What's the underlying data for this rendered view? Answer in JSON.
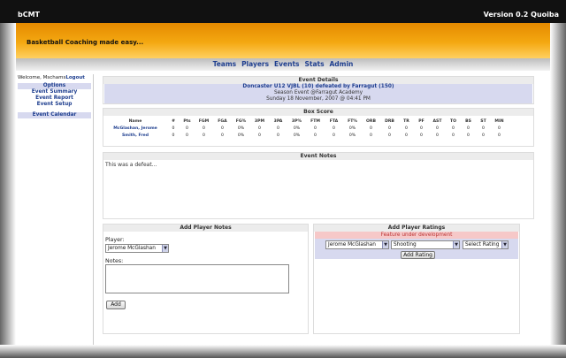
{
  "app": {
    "name": "bCMT",
    "version": "Version 0.2 Quoiba"
  },
  "banner": {
    "tagline": "Basketball Coaching made easy..."
  },
  "nav": [
    "Teams",
    "Players",
    "Events",
    "Stats",
    "Admin"
  ],
  "sidebar": {
    "welcome_prefix": "Welcome, Mschams",
    "logout": "Logout",
    "items1": [
      "Options",
      "Event Summary",
      "Event Report",
      "Event Setup"
    ],
    "items2": [
      "Event Calendar"
    ]
  },
  "event_details": {
    "title": "Event Details",
    "teams": "Doncaster U12 VJBL (10) defeated by Farragut (150)",
    "type": "Season Event @Farragut Academy",
    "datetime": "Sunday 18 November, 2007 @ 04:41 PM"
  },
  "box_score": {
    "title": "Box Score",
    "columns": [
      "Name",
      "#",
      "Pts",
      "FGM",
      "FGA",
      "FG%",
      "3PM",
      "3PA",
      "3P%",
      "FTM",
      "FTA",
      "FT%",
      "ORB",
      "DRB",
      "TR",
      "PF",
      "AST",
      "TO",
      "BS",
      "ST",
      "MIN"
    ],
    "rows": [
      [
        "McGlashan, Jerome",
        "0",
        "0",
        "0",
        "0",
        "0%",
        "0",
        "0",
        "0%",
        "0",
        "0",
        "0%",
        "0",
        "0",
        "0",
        "0",
        "0",
        "0",
        "0",
        "0",
        "0"
      ],
      [
        "Smith, Fred",
        "0",
        "0",
        "0",
        "0",
        "0%",
        "0",
        "0",
        "0%",
        "0",
        "0",
        "0%",
        "0",
        "0",
        "0",
        "0",
        "0",
        "0",
        "0",
        "0",
        "0"
      ]
    ]
  },
  "event_notes": {
    "title": "Event Notes",
    "text": "This was a defeat..."
  },
  "add_player_notes": {
    "title": "Add Player Notes",
    "player_label": "Player:",
    "player_value": "Jerome McGlashan",
    "notes_label": "Notes:",
    "add_button": "Add"
  },
  "add_player_ratings": {
    "title": "Add Player Ratings",
    "warning": "Feature under development",
    "player_value": "Jerome McGlashan",
    "skill_value": "Shooting",
    "rating_value": "Select Rating",
    "add_button": "Add Rating"
  },
  "colors": {
    "accent": "#f4a811",
    "link": "#1f3f8f",
    "highlight": "#d7d9ef",
    "warning_bg": "#f6c8c8"
  }
}
